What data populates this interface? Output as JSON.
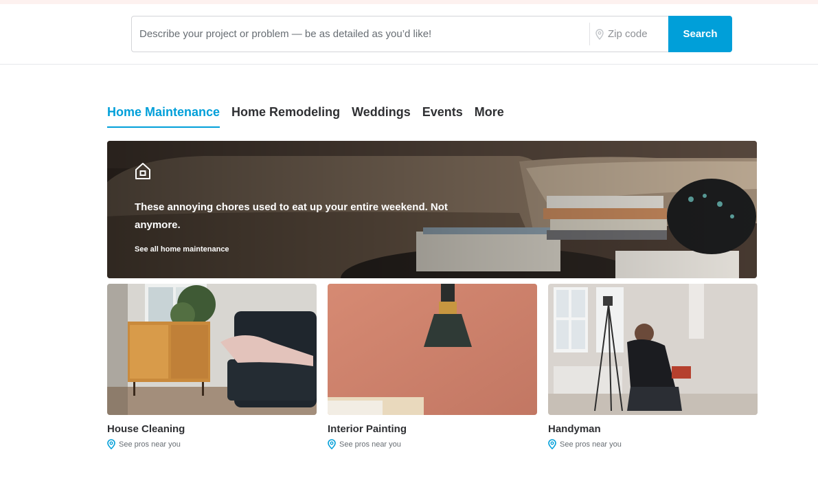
{
  "search": {
    "project_placeholder": "Describe your project or problem — be as detailed as you’d like!",
    "zip_placeholder": "Zip code",
    "button_label": "Search"
  },
  "tabs": [
    {
      "label": "Home Maintenance",
      "active": true
    },
    {
      "label": "Home Remodeling",
      "active": false
    },
    {
      "label": "Weddings",
      "active": false
    },
    {
      "label": "Events",
      "active": false
    },
    {
      "label": "More",
      "active": false
    }
  ],
  "hero": {
    "icon": "house-icon",
    "headline": "These annoying chores used to eat up your entire weekend. Not anymore.",
    "link_label": "See all home maintenance"
  },
  "cards": [
    {
      "title": "House Cleaning",
      "subtitle": "See pros near you"
    },
    {
      "title": "Interior Painting",
      "subtitle": "See pros near you"
    },
    {
      "title": "Handyman",
      "subtitle": "See pros near you"
    }
  ],
  "colors": {
    "accent": "#009fd9",
    "text": "#2f3033",
    "muted": "#676d73",
    "top_strip": "#fdf1ef"
  }
}
